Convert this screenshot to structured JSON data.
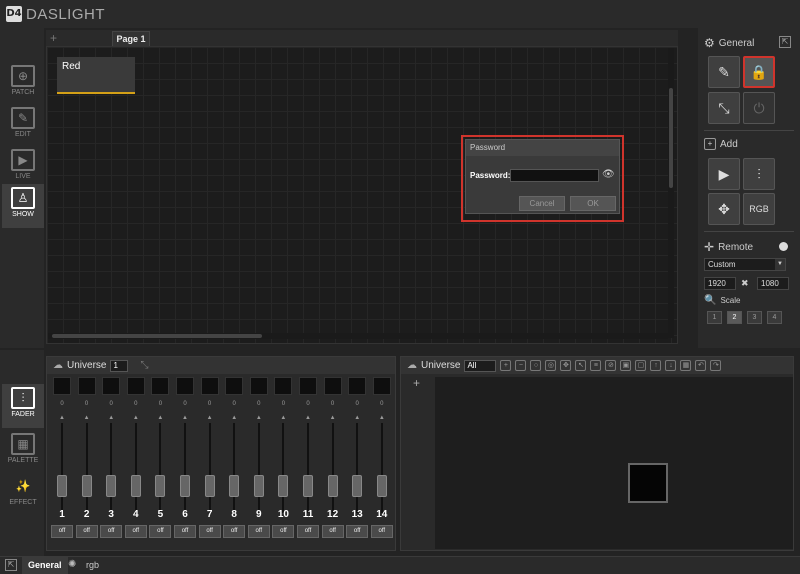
{
  "app": {
    "logo_mark": "D4",
    "name": "DASLIGHT"
  },
  "left_nav": [
    {
      "label": "PATCH",
      "icon": "patch-icon"
    },
    {
      "label": "EDIT",
      "icon": "edit-icon"
    },
    {
      "label": "LIVE",
      "icon": "live-icon"
    },
    {
      "label": "SHOW",
      "icon": "show-icon",
      "active": true
    }
  ],
  "page": {
    "add": "+",
    "tab": "Page 1",
    "button_label": "Red"
  },
  "password_dialog": {
    "title": "Password",
    "label": "Password:",
    "value": "",
    "cancel": "Cancel",
    "ok": "OK"
  },
  "right_panel": {
    "general": "General",
    "add": "Add",
    "remote": "Remote",
    "resolution_preset": "Custom",
    "width": "1920",
    "height": "1080",
    "times": "✖",
    "scale": "Scale",
    "scale_buttons": [
      "1",
      "2",
      "3",
      "4"
    ],
    "scale_selected": "2"
  },
  "bottom_nav": [
    {
      "label": "FADER",
      "icon": "fader-icon",
      "active": true
    },
    {
      "label": "PALETTE",
      "icon": "palette-icon"
    },
    {
      "label": "EFFECT",
      "icon": "effect-icon"
    }
  ],
  "fader_panel": {
    "title": "Universe",
    "universe": "1",
    "channels": [
      "1",
      "2",
      "3",
      "4",
      "5",
      "6",
      "7",
      "8",
      "9",
      "10",
      "11",
      "12",
      "13",
      "14"
    ],
    "level": "0",
    "off_label": "off"
  },
  "universe_panel": {
    "title": "Universe",
    "selection": "All",
    "add": "+"
  },
  "status_tabs": [
    "General",
    "rgb"
  ],
  "colors": {
    "accent_highlight": "#d0342c",
    "active_underline": "#d4a017"
  }
}
